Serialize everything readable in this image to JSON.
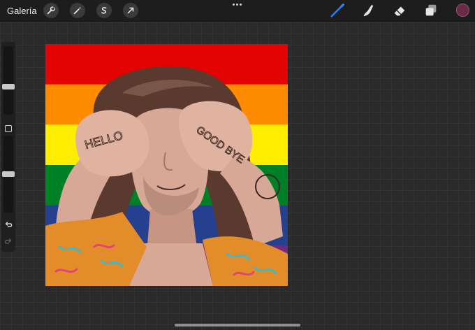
{
  "topbar": {
    "gallery_label": "Galería",
    "left_tools": [
      {
        "name": "actions",
        "icon": "wrench-icon"
      },
      {
        "name": "adjustments",
        "icon": "magic-wand-icon"
      },
      {
        "name": "selection",
        "icon": "selection-s-icon"
      },
      {
        "name": "transform",
        "icon": "arrow-cursor-icon"
      }
    ],
    "right_tools": [
      {
        "name": "brush",
        "icon": "brush-icon",
        "active": true
      },
      {
        "name": "smudge",
        "icon": "smudge-finger-icon"
      },
      {
        "name": "eraser",
        "icon": "eraser-icon"
      },
      {
        "name": "layers",
        "icon": "layers-icon"
      },
      {
        "name": "color",
        "icon": "color-swatch",
        "value": "#6b2a46"
      }
    ]
  },
  "sidebar": {
    "brush_size": 0.4,
    "opacity": 0.5,
    "buttons": [
      "modify-square-icon",
      "undo-icon",
      "redo-icon"
    ]
  },
  "canvas_art": {
    "flag_colors": [
      "#e40303",
      "#ff8c00",
      "#ffed00",
      "#008026",
      "#24408e",
      "#732982"
    ],
    "hand_texts": [
      "HELLO",
      "GOOD BYE"
    ]
  },
  "colors": {
    "accent": "#2f7ff5",
    "background": "#2a2a2a",
    "toolbar": "#1d1d1d"
  }
}
